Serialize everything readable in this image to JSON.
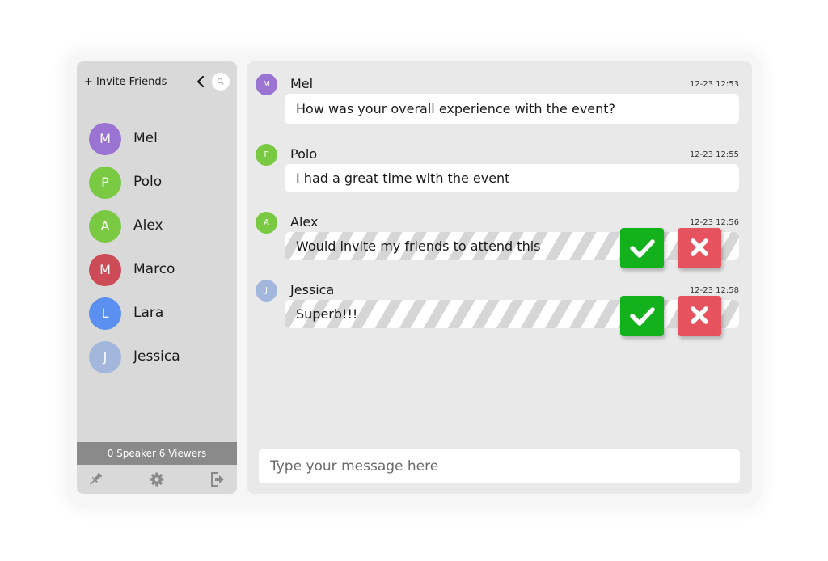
{
  "sidebar": {
    "invite_label": "+ Invite Friends",
    "collapse_icon": "chevron-left-icon",
    "search_icon": "search-icon",
    "contacts": [
      {
        "name": "Mel",
        "initial": "M",
        "color": "#9b74d3"
      },
      {
        "name": "Polo",
        "initial": "P",
        "color": "#7ac943"
      },
      {
        "name": "Alex",
        "initial": "A",
        "color": "#7ac943"
      },
      {
        "name": "Marco",
        "initial": "M",
        "color": "#cc4b57"
      },
      {
        "name": "Lara",
        "initial": "L",
        "color": "#5b8ff0"
      },
      {
        "name": "Jessica",
        "initial": "J",
        "color": "#a3b7dd"
      }
    ],
    "status": "0 Speaker 6 Viewers",
    "footer_icons": [
      "pin-icon",
      "gear-icon",
      "exit-icon"
    ]
  },
  "chat": {
    "messages": [
      {
        "sender": "Mel",
        "initial": "M",
        "color": "#9b74d3",
        "time": "12-23 12:53",
        "text": "How was your overall experience with the event?",
        "pending": false
      },
      {
        "sender": "Polo",
        "initial": "P",
        "color": "#7ac943",
        "time": "12-23 12:55",
        "text": "I had a great time with the event",
        "pending": false
      },
      {
        "sender": "Alex",
        "initial": "A",
        "color": "#7ac943",
        "time": "12-23 12:56",
        "text": "Would invite my friends to attend this",
        "pending": true
      },
      {
        "sender": "Jessica",
        "initial": "J",
        "color": "#a3b7dd",
        "time": "12-23 12:58",
        "text": "Superb!!!",
        "pending": true
      }
    ],
    "approve_color": "#13b11c",
    "reject_color": "#e6525e",
    "input_placeholder": "Type your message here",
    "input_value": ""
  }
}
